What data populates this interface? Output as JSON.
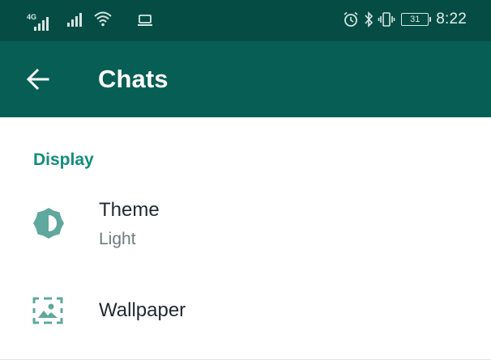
{
  "status_bar": {
    "network_label": "4G",
    "battery_level": "31",
    "time": "8:22"
  },
  "app_bar": {
    "title": "Chats"
  },
  "display_section": {
    "header": "Display",
    "items": [
      {
        "title": "Theme",
        "subtitle": "Light",
        "icon": "theme-icon"
      },
      {
        "title": "Wallpaper",
        "icon": "wallpaper-icon"
      }
    ]
  },
  "colors": {
    "status_bar_bg": "#054d44",
    "app_bar_bg": "#075e54",
    "accent": "#128c7e",
    "icon_tint": "#5fa89d"
  }
}
